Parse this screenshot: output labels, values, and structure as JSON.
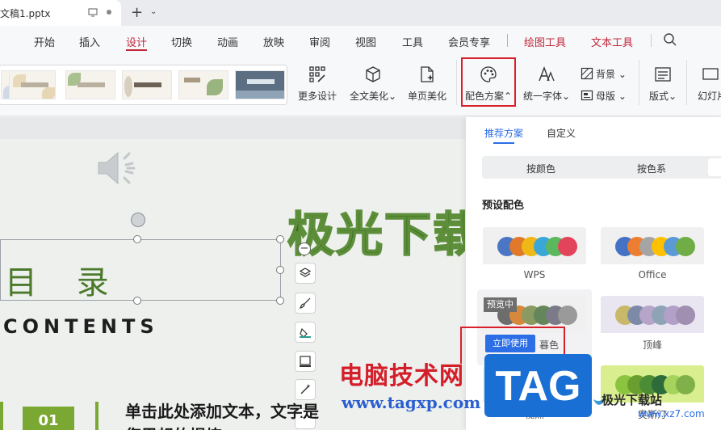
{
  "window": {
    "doc_tab_title": "文稿1.pptx",
    "add_tab": "+",
    "tab_menu": "⌄"
  },
  "menu": {
    "items": [
      "开始",
      "插入",
      "设计",
      "切换",
      "动画",
      "放映",
      "审阅",
      "视图",
      "工具",
      "会员专享"
    ],
    "active": "设计",
    "context_items": [
      "绘图工具",
      "文本工具"
    ]
  },
  "ribbon": {
    "more_design": "更多设计",
    "beautify_all": "全文美化",
    "beautify_page": "单页美化",
    "color_scheme": "配色方案",
    "unify_font": "统一字体",
    "background": "背景",
    "master": "母版",
    "layout": "版式",
    "slide_size": "幻灯片"
  },
  "slide": {
    "headline": "极光下载",
    "toc_title": "目 录",
    "toc_subtitle": "CONTENTS",
    "number": "01",
    "body_line1": "单击此处添加文本，文字是",
    "body_line2": "您思想的提炼",
    "minus": "−",
    "more_tools": "···"
  },
  "panel": {
    "tabs": [
      "推荐方案",
      "自定义"
    ],
    "active_tab": "推荐方案",
    "segments": [
      "按颜色",
      "按色系"
    ],
    "section_title": "预设配色",
    "schemes": [
      {
        "name": "WPS",
        "colors": [
          "#4a76c4",
          "#e07a2a",
          "#f0b816",
          "#3aa7d8",
          "#5cb85c",
          "#e2445c"
        ]
      },
      {
        "name": "Office",
        "colors": [
          "#4472c4",
          "#ed7d31",
          "#a5a5a5",
          "#ffc000",
          "#5b9bd5",
          "#70ad47"
        ]
      },
      {
        "name": "暮色",
        "colors": [
          "#6d6d6d",
          "#d6893a",
          "#8a9a63",
          "#64865a",
          "#7a7a88",
          "#9a9a9a"
        ]
      },
      {
        "name": "顶峰",
        "colors": [
          "#c8b86a",
          "#7c8aa8",
          "#b7a4c9",
          "#8fa3b6",
          "#b3a0c9",
          "#a08fb0"
        ]
      },
      {
        "name": "视点",
        "colors": [
          "#3c74c6",
          "#4a8dd6",
          "#3a6fba",
          "#2f5f9f",
          "#5c8ed8",
          "#4a7cc6"
        ]
      },
      {
        "name": "奥斯汀",
        "colors": [
          "#8bc53f",
          "#6a9f2f",
          "#4d8c36",
          "#2d6b3a",
          "#a5d35b",
          "#7fb049"
        ]
      }
    ],
    "preview_badge": "预览中",
    "apply_button": "立即使用"
  },
  "watermark": {
    "text": "电脑技术网",
    "url": "www.tagxp.com",
    "logo": "TAG",
    "site_name": "极光下载站",
    "site_url": "www.xz7.com"
  },
  "colors": {
    "accent_red": "#c0283a",
    "highlight_red": "#d8202a",
    "panel_blue": "#2b6ee6",
    "slide_green": "#4a7a2a"
  }
}
